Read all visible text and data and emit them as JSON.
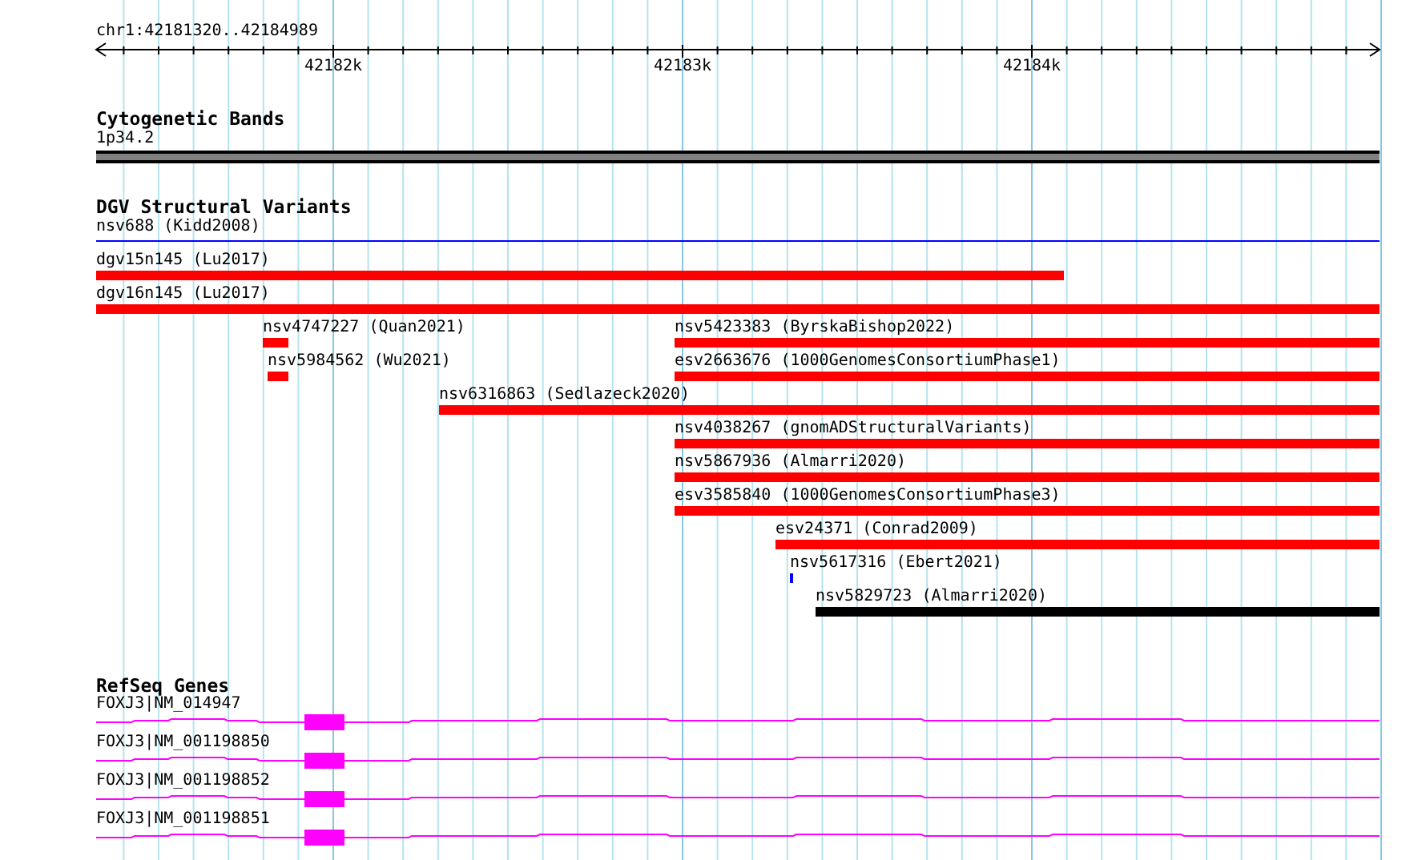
{
  "ruler": {
    "location": "chr1:42181320..42184989",
    "ticks": [
      "42182k",
      "42183k",
      "42184k"
    ]
  },
  "cytogenetic_bands": {
    "title": "Cytogenetic Bands",
    "bands": [
      {
        "label": "1p34.2"
      }
    ]
  },
  "dgv_structural_variants": {
    "title": "DGV Structural Variants",
    "rows": [
      [
        {
          "label": "nsv688 (Kidd2008)",
          "kind": "line",
          "color": "#0000ff"
        }
      ],
      [
        {
          "label": "dgv15n145 (Lu2017)",
          "kind": "bar",
          "color": "#ff0000"
        }
      ],
      [
        {
          "label": "dgv16n145 (Lu2017)",
          "kind": "bar",
          "color": "#ff0000"
        }
      ],
      [
        {
          "label": "nsv4747227 (Quan2021)",
          "kind": "bar",
          "color": "#ff0000"
        },
        {
          "label": "nsv5423383 (ByrskaBishop2022)",
          "kind": "bar",
          "color": "#ff0000"
        }
      ],
      [
        {
          "label": "nsv5984562 (Wu2021)",
          "kind": "bar",
          "color": "#ff0000"
        },
        {
          "label": "esv2663676 (1000GenomesConsortiumPhase1)",
          "kind": "bar",
          "color": "#ff0000"
        }
      ],
      [
        {
          "label": "nsv6316863 (Sedlazeck2020)",
          "kind": "bar",
          "color": "#ff0000"
        }
      ],
      [
        {
          "label": "nsv4038267 (gnomADStructuralVariants)",
          "kind": "bar",
          "color": "#ff0000"
        }
      ],
      [
        {
          "label": "nsv5867936 (Almarri2020)",
          "kind": "bar",
          "color": "#ff0000"
        }
      ],
      [
        {
          "label": "esv3585840 (1000GenomesConsortiumPhase3)",
          "kind": "bar",
          "color": "#ff0000"
        }
      ],
      [
        {
          "label": "esv24371 (Conrad2009)",
          "kind": "bar",
          "color": "#ff0000"
        }
      ],
      [
        {
          "label": "nsv5617316 (Ebert2021)",
          "kind": "bar",
          "color": "#0000ff"
        }
      ],
      [
        {
          "label": "nsv5829723 (Almarri2020)",
          "kind": "bar",
          "color": "#000000"
        }
      ]
    ]
  },
  "refseq_genes": {
    "title": "RefSeq Genes",
    "transcripts": [
      {
        "label": "FOXJ3|NM_014947"
      },
      {
        "label": "FOXJ3|NM_001198850"
      },
      {
        "label": "FOXJ3|NM_001198852"
      },
      {
        "label": "FOXJ3|NM_001198851"
      }
    ]
  }
}
